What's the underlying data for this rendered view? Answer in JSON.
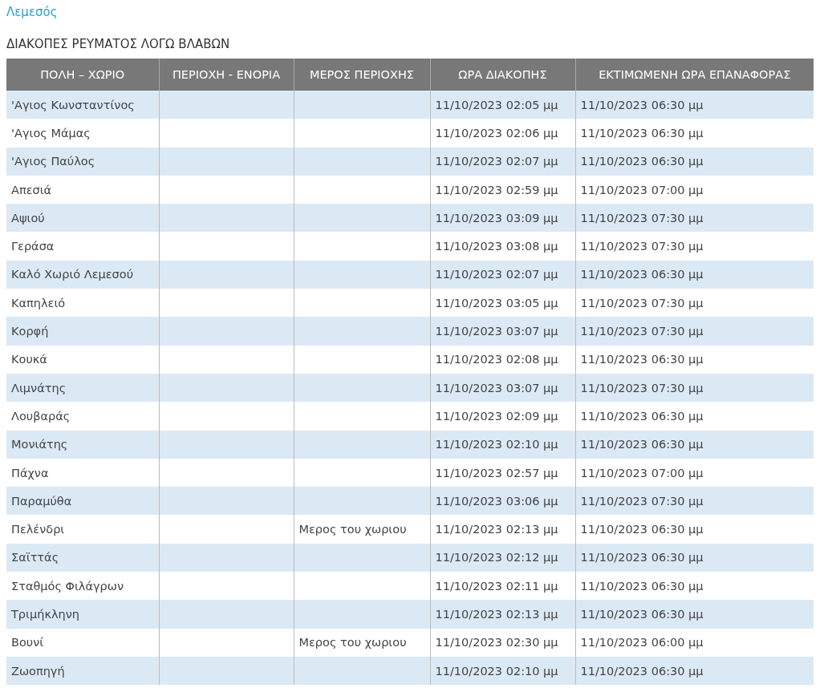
{
  "region_link": "Λεμεσός",
  "heading": "ΔΙΑΚΟΠΕΣ ΡΕΥΜΑΤΟΣ ΛΟΓΩ ΒΛΑΒΩΝ",
  "table": {
    "columns": [
      "ΠΟΛΗ – ΧΩΡΙΟ",
      "ΠΕΡΙΟΧΗ - ΕΝΟΡΙΑ",
      "ΜΕΡΟΣ ΠΕΡΙΟΧΗΣ",
      "ΩΡΑ ΔΙΑΚΟΠΗΣ",
      "ΕΚΤΙΜΩΜΕΝΗ ΩΡΑ ΕΠΑΝΑΦΟΡΑΣ"
    ],
    "rows": [
      {
        "town": "'Αγιος Κωνσταντίνος",
        "outage_time": "11/10/2023 02:05 μμ",
        "restore_time": "11/10/2023 06:30 μμ"
      },
      {
        "town": "'Αγιος Μάμας",
        "outage_time": "11/10/2023 02:06 μμ",
        "restore_time": "11/10/2023 06:30 μμ"
      },
      {
        "town": "'Αγιος Παύλος",
        "outage_time": "11/10/2023 02:07 μμ",
        "restore_time": "11/10/2023 06:30 μμ"
      },
      {
        "town": "Απεσιά",
        "outage_time": "11/10/2023 02:59 μμ",
        "restore_time": "11/10/2023 07:00 μμ"
      },
      {
        "town": "Αψιού",
        "outage_time": "11/10/2023 03:09 μμ",
        "restore_time": "11/10/2023 07:30 μμ"
      },
      {
        "town": "Γεράσα",
        "outage_time": "11/10/2023 03:08 μμ",
        "restore_time": "11/10/2023 07:30 μμ"
      },
      {
        "town": "Καλό Χωριό Λεμεσού",
        "outage_time": "11/10/2023 02:07 μμ",
        "restore_time": "11/10/2023 06:30 μμ"
      },
      {
        "town": "Καπηλειό",
        "outage_time": "11/10/2023 03:05 μμ",
        "restore_time": "11/10/2023 07:30 μμ"
      },
      {
        "town": "Κορφή",
        "outage_time": "11/10/2023 03:07 μμ",
        "restore_time": "11/10/2023 07:30 μμ"
      },
      {
        "town": "Κουκά",
        "outage_time": "11/10/2023 02:08 μμ",
        "restore_time": "11/10/2023 06:30 μμ"
      },
      {
        "town": "Λιμνάτης",
        "outage_time": "11/10/2023 03:07 μμ",
        "restore_time": "11/10/2023 07:30 μμ"
      },
      {
        "town": "Λουβαράς",
        "outage_time": "11/10/2023 02:09 μμ",
        "restore_time": "11/10/2023 06:30 μμ"
      },
      {
        "town": "Μονιάτης",
        "outage_time": "11/10/2023 02:10 μμ",
        "restore_time": "11/10/2023 06:30 μμ"
      },
      {
        "town": "Πάχνα",
        "outage_time": "11/10/2023 02:57 μμ",
        "restore_time": "11/10/2023 07:00 μμ"
      },
      {
        "town": "Παραμύθα",
        "outage_time": "11/10/2023 03:06 μμ",
        "restore_time": "11/10/2023 07:30 μμ"
      },
      {
        "town": "Πελένδρι",
        "area_part": "Μερος του χωριου",
        "outage_time": "11/10/2023 02:13 μμ",
        "restore_time": "11/10/2023 06:30 μμ"
      },
      {
        "town": "Σαϊττάς",
        "outage_time": "11/10/2023 02:12 μμ",
        "restore_time": "11/10/2023 06:30 μμ"
      },
      {
        "town": "Σταθμός Φιλάγρων",
        "outage_time": "11/10/2023 02:11 μμ",
        "restore_time": "11/10/2023 06:30 μμ"
      },
      {
        "town": "Τριμήκληνη",
        "outage_time": "11/10/2023 02:13 μμ",
        "restore_time": "11/10/2023 06:30 μμ"
      },
      {
        "town": "Βουνί",
        "area_part": "Μερος του χωριου",
        "outage_time": "11/10/2023 02:30 μμ",
        "restore_time": "11/10/2023 06:00 μμ"
      },
      {
        "town": "Ζωοπηγή",
        "outage_time": "11/10/2023 02:10 μμ",
        "restore_time": "11/10/2023 06:30 μμ"
      }
    ]
  }
}
